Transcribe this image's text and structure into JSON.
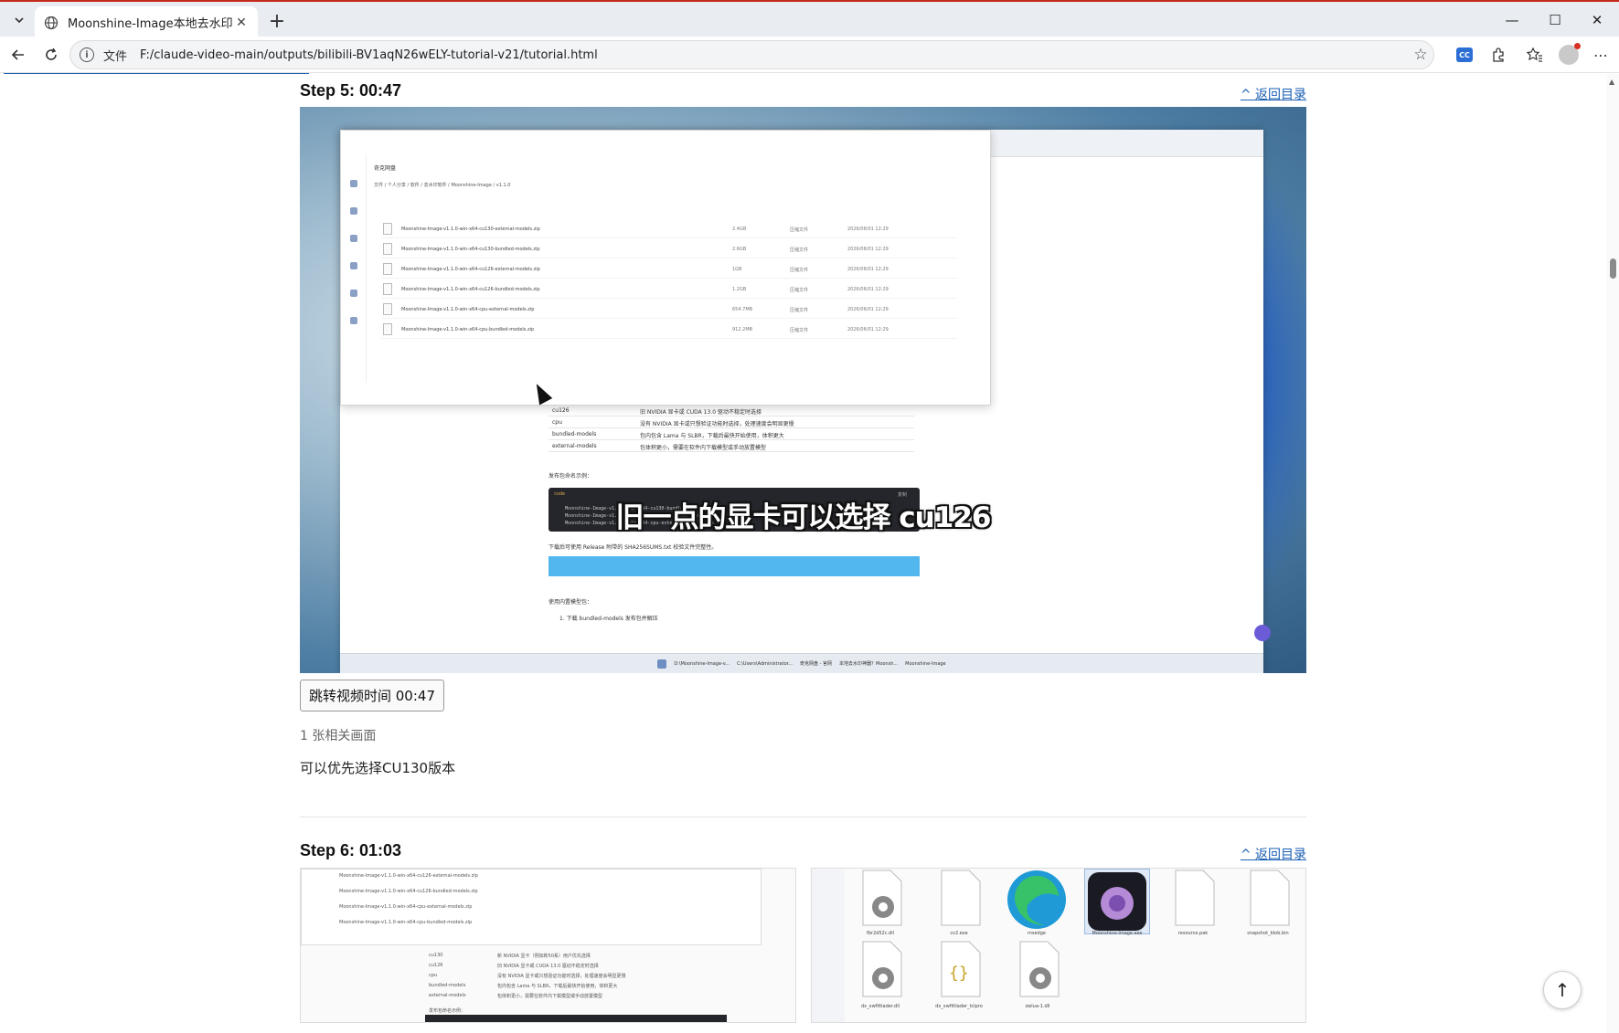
{
  "browser": {
    "tab_title": "Moonshine-Image本地去水印：从",
    "url_scheme": "文件",
    "url": "F:/claude-video-main/outputs/bilibili-BV1aqN26wELY-tutorial-v21/tutorial.html",
    "icons": [
      "tab-list-icon",
      "globe-icon",
      "close-icon",
      "plus-icon",
      "minimize-icon",
      "maximize-icon",
      "close-window-icon",
      "back-icon",
      "refresh-icon",
      "info-icon",
      "star-icon",
      "cc-icon",
      "extensions-icon",
      "favorites-icon",
      "profile-icon",
      "more-icon"
    ]
  },
  "steps": [
    {
      "title": "Step 5: 00:47",
      "back_link": "^ 返回目录",
      "jump_button": "跳转视频时间 00:47",
      "image_count": "1 张相关画面",
      "description": "可以优先选择CU130版本",
      "screenshot": {
        "subtitle": "旧一点的显卡可以选择 cu126",
        "files": [
          {
            "name": "Moonshine-Image-v1.1.0-win-x64-cu130-external-models.zip",
            "size": "2.4GB",
            "type": "压缩文件",
            "date": "2026/06/01 12:29"
          },
          {
            "name": "Moonshine-Image-v1.1.0-win-x64-cu130-bundled-models.zip",
            "size": "2.6GB",
            "type": "压缩文件",
            "date": "2026/06/01 12:29"
          },
          {
            "name": "Moonshine-Image-v1.1.0-win-x64-cu126-external-models.zip",
            "size": "1GB",
            "type": "压缩文件",
            "date": "2026/06/01 12:29"
          },
          {
            "name": "Moonshine-Image-v1.1.0-win-x64-cu126-bundled-models.zip",
            "size": "1.2GB",
            "type": "压缩文件",
            "date": "2026/06/01 12:29"
          },
          {
            "name": "Moonshine-Image-v1.1.0-win-x64-cpu-external-models.zip",
            "size": "654.7MB",
            "type": "压缩文件",
            "date": "2026/06/01 12:29"
          },
          {
            "name": "Moonshine-Image-v1.1.0-win-x64-cpu-bundled-models.zip",
            "size": "912.2MB",
            "type": "压缩文件",
            "date": "2026/06/01 12:29"
          }
        ],
        "popup_header": "奇克网盘",
        "breadcrumb": "文件 / 个人分享 / 软件 / 去水印软件 / Moonshine-Image / v1.1.0",
        "spec_rows": [
          {
            "k": "cu130",
            "v": "新 NVIDIA 显卡（例如新50系）用户优先选择"
          },
          {
            "k": "cu126",
            "v": "旧 NVIDIA 显卡或 CUDA 13.0 驱动不稳定时选择"
          },
          {
            "k": "cpu",
            "v": "没有 NVIDIA 显卡或只想验证功能时选择，处理速度会明显更慢"
          },
          {
            "k": "bundled-models",
            "v": "包内包含 Lama 与 SLBR，下载后最快开始使用，体积更大"
          },
          {
            "k": "external-models",
            "v": "包体积更小，需要在软件内下载模型或手动放置模型"
          }
        ],
        "code_title": "code",
        "code_copy": "复制",
        "code_lines": [
          "Moonshine-Image-v1.1.0-win-x64-cu130-bundled-models.zip",
          "Moonshine-Image-v1.1.0-win-x64-cu126-external-models.zip",
          "Moonshine-Image-v1.1.0-win-x64-cpu-external-models.zip"
        ],
        "note_release": "下载后可使用 Release 附带的 SHA256SUMS.txt 校验文件完整性。",
        "note_packages": "发布包命名示例：",
        "note_models": "使用内置模型包：",
        "note_step1": "1. 下载 bundled-models 发布包并解压",
        "taskbar_items": [
          "D:\\Moonshine-Image-v...",
          "C:\\Users\\Administrator...",
          "奇克网盘 - 官网",
          "本地去水印神器？Moonsh...",
          "Moonshine-Image"
        ]
      }
    },
    {
      "title": "Step 6: 01:03",
      "back_link": "^ 返回目录",
      "explorer_labels": [
        "fbr2d52c.dll",
        "cv2.exe",
        "msedge",
        "Moonshine-Image.exe",
        "resource.pak",
        "snapshot_blob.bin",
        "dx_xwfiltlader.dll",
        "dx_xwfiltlader_tclpro",
        "zwlua-1.dll"
      ]
    }
  ]
}
